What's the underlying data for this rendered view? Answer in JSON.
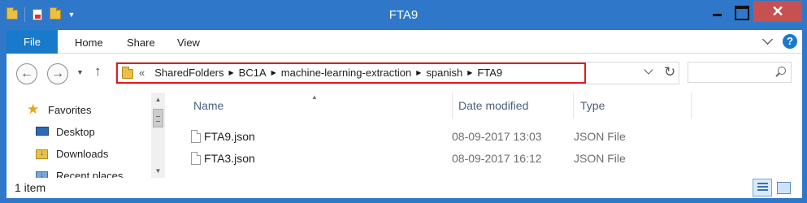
{
  "window": {
    "title": "FTA9",
    "close_glyph": "✕"
  },
  "ribbon": {
    "tabs": [
      "File",
      "Home",
      "Share",
      "View"
    ],
    "help_glyph": "?"
  },
  "nav": {
    "back_glyph": "←",
    "forward_glyph": "→",
    "up_glyph": "↑",
    "refresh_glyph": "↻",
    "overflow_glyph": "«",
    "breadcrumbs": [
      "SharedFolders",
      "BC1A",
      "machine-learning-extraction",
      "spanish",
      "FTA9"
    ],
    "highlight_color": "#e01c23"
  },
  "search": {
    "placeholder": ""
  },
  "navpane": {
    "items": [
      {
        "label": "Favorites",
        "icon": "star-icon"
      },
      {
        "label": "Desktop",
        "icon": "desktop-icon"
      },
      {
        "label": "Downloads",
        "icon": "downloads-folder-icon"
      },
      {
        "label": "Recent places",
        "icon": "recent-places-icon"
      }
    ]
  },
  "filelist": {
    "columns": [
      "Name",
      "Date modified",
      "Type"
    ],
    "rows": [
      {
        "name": "FTA9.json",
        "date": "08-09-2017 13:03",
        "type": "JSON File",
        "icon": "file-icon"
      },
      {
        "name": "FTA3.json",
        "date": "08-09-2017 16:12",
        "type": "JSON File",
        "icon": "file-icon"
      }
    ]
  },
  "status": {
    "item_count": "1 item"
  },
  "colors": {
    "titlebar": "#2f78c9",
    "file_tab": "#1979ca",
    "close_button": "#c75050"
  }
}
